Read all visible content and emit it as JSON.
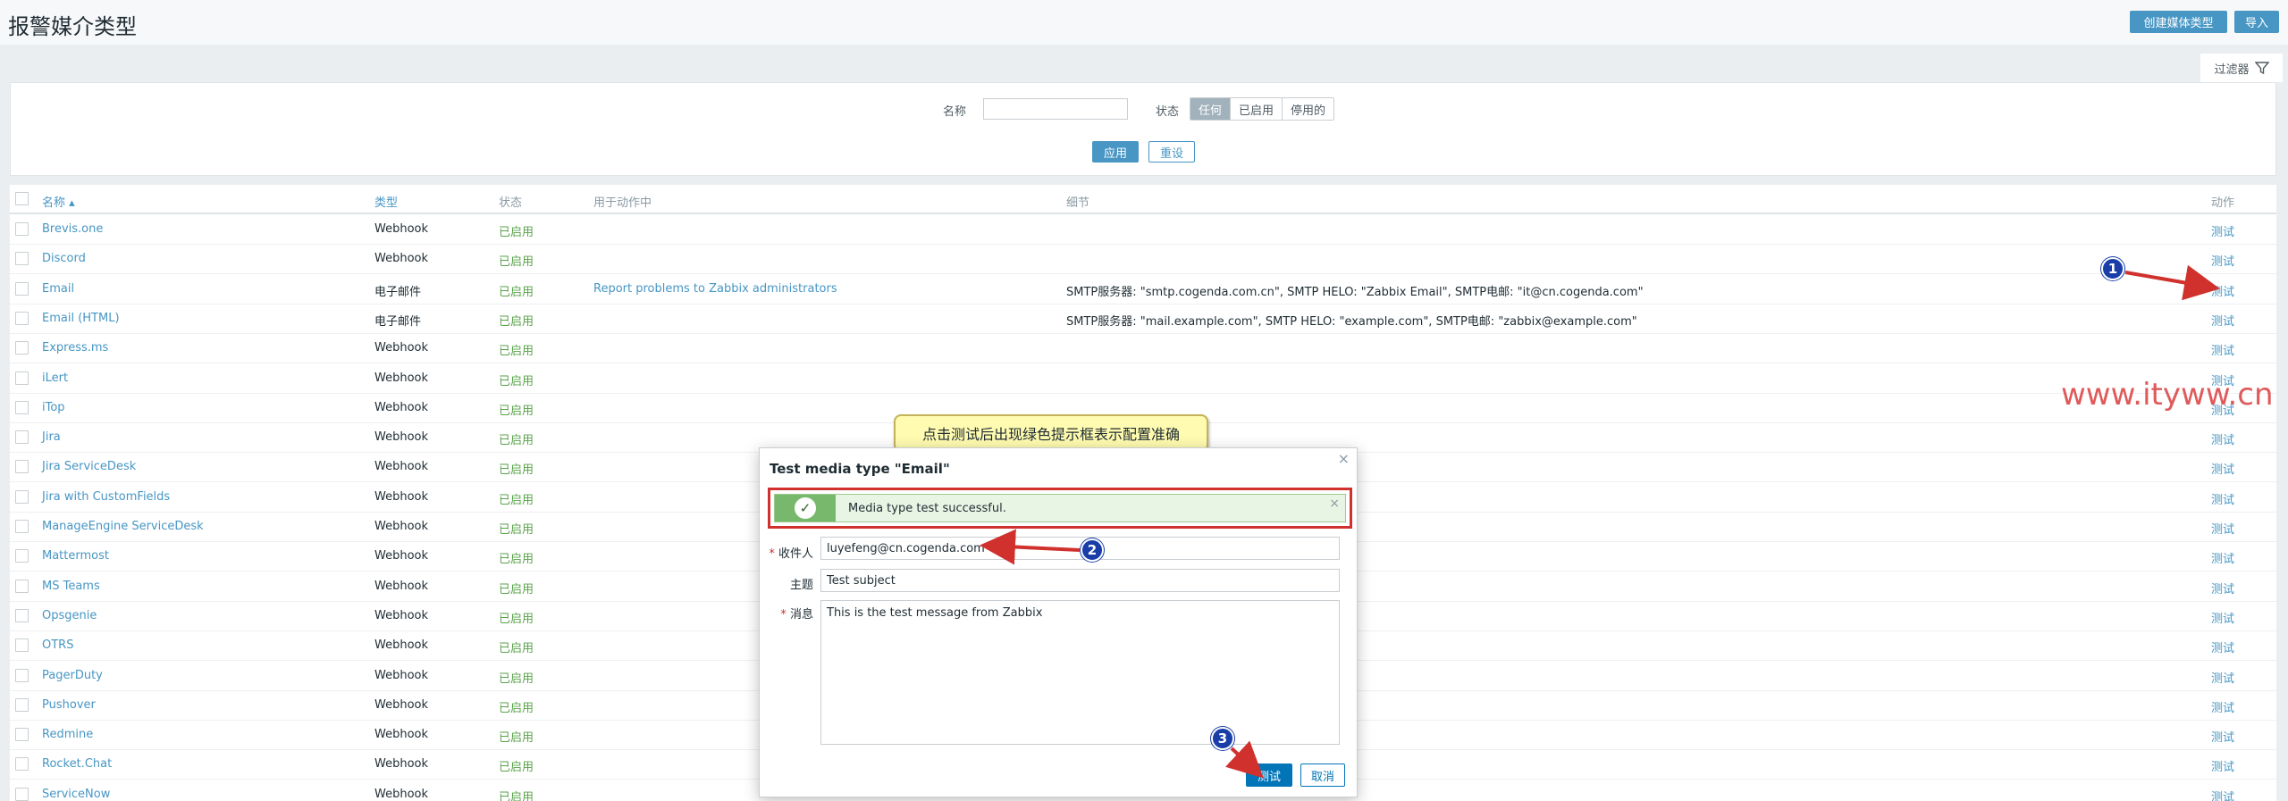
{
  "header": {
    "title": "报警媒介类型",
    "create_label": "创建媒体类型",
    "import_label": "导入"
  },
  "filter": {
    "tab_label": "过滤器",
    "name_label": "名称",
    "name_value": "",
    "status_label": "状态",
    "status_options": [
      "任何",
      "已启用",
      "停用的"
    ],
    "apply_label": "应用",
    "reset_label": "重设"
  },
  "table": {
    "headers": [
      "名称 ▴",
      "类型",
      "状态",
      "用于动作中",
      "细节",
      "动作"
    ],
    "rows": [
      {
        "name": "Brevis.one",
        "type": "Webhook",
        "status": "已启用",
        "used_in": "",
        "details": "",
        "action": "测试"
      },
      {
        "name": "Discord",
        "type": "Webhook",
        "status": "已启用",
        "used_in": "",
        "details": "",
        "action": "测试"
      },
      {
        "name": "Email",
        "type": "电子邮件",
        "status": "已启用",
        "used_in": "Report problems to Zabbix administrators",
        "details": "SMTP服务器: \"smtp.cogenda.com.cn\", SMTP HELO: \"Zabbix Email\", SMTP电邮: \"it@cn.cogenda.com\"",
        "action": "测试"
      },
      {
        "name": "Email (HTML)",
        "type": "电子邮件",
        "status": "已启用",
        "used_in": "",
        "details": "SMTP服务器: \"mail.example.com\", SMTP HELO: \"example.com\", SMTP电邮: \"zabbix@example.com\"",
        "action": "测试"
      },
      {
        "name": "Express.ms",
        "type": "Webhook",
        "status": "已启用",
        "used_in": "",
        "details": "",
        "action": "测试"
      },
      {
        "name": "iLert",
        "type": "Webhook",
        "status": "已启用",
        "used_in": "",
        "details": "",
        "action": "测试"
      },
      {
        "name": "iTop",
        "type": "Webhook",
        "status": "已启用",
        "used_in": "",
        "details": "",
        "action": "测试"
      },
      {
        "name": "Jira",
        "type": "Webhook",
        "status": "已启用",
        "used_in": "",
        "details": "",
        "action": "测试"
      },
      {
        "name": "Jira ServiceDesk",
        "type": "Webhook",
        "status": "已启用",
        "used_in": "",
        "details": "",
        "action": "测试"
      },
      {
        "name": "Jira with CustomFields",
        "type": "Webhook",
        "status": "已启用",
        "used_in": "",
        "details": "",
        "action": "测试"
      },
      {
        "name": "ManageEngine ServiceDesk",
        "type": "Webhook",
        "status": "已启用",
        "used_in": "",
        "details": "",
        "action": "测试"
      },
      {
        "name": "Mattermost",
        "type": "Webhook",
        "status": "已启用",
        "used_in": "",
        "details": "",
        "action": "测试"
      },
      {
        "name": "MS Teams",
        "type": "Webhook",
        "status": "已启用",
        "used_in": "",
        "details": "",
        "action": "测试"
      },
      {
        "name": "Opsgenie",
        "type": "Webhook",
        "status": "已启用",
        "used_in": "",
        "details": "",
        "action": "测试"
      },
      {
        "name": "OTRS",
        "type": "Webhook",
        "status": "已启用",
        "used_in": "",
        "details": "",
        "action": "测试"
      },
      {
        "name": "PagerDuty",
        "type": "Webhook",
        "status": "已启用",
        "used_in": "",
        "details": "",
        "action": "测试"
      },
      {
        "name": "Pushover",
        "type": "Webhook",
        "status": "已启用",
        "used_in": "",
        "details": "",
        "action": "测试"
      },
      {
        "name": "Redmine",
        "type": "Webhook",
        "status": "已启用",
        "used_in": "",
        "details": "",
        "action": "测试"
      },
      {
        "name": "Rocket.Chat",
        "type": "Webhook",
        "status": "已启用",
        "used_in": "",
        "details": "",
        "action": "测试"
      },
      {
        "name": "ServiceNow",
        "type": "Webhook",
        "status": "已启用",
        "used_in": "",
        "details": "",
        "action": "测试"
      }
    ]
  },
  "watermark": "www.ityww.cn",
  "callout": "点击测试后出现绿色提示框表示配置准确",
  "dialog": {
    "title": "Test media type \"Email\"",
    "success_message": "Media type test successful.",
    "to_label": "收件人",
    "to_value": "luyefeng@cn.cogenda.com",
    "subject_label": "主题",
    "subject_value": "Test subject",
    "message_label": "消息",
    "message_value": "This is the test message from Zabbix",
    "test_label": "测试",
    "cancel_label": "取消"
  },
  "annotations": [
    "1",
    "2",
    "3"
  ],
  "colors": {
    "primary": "#4796c4",
    "enabled_green": "#59a24a",
    "annotation_red": "#d0312d",
    "badge_blue": "#1a3ea8"
  }
}
